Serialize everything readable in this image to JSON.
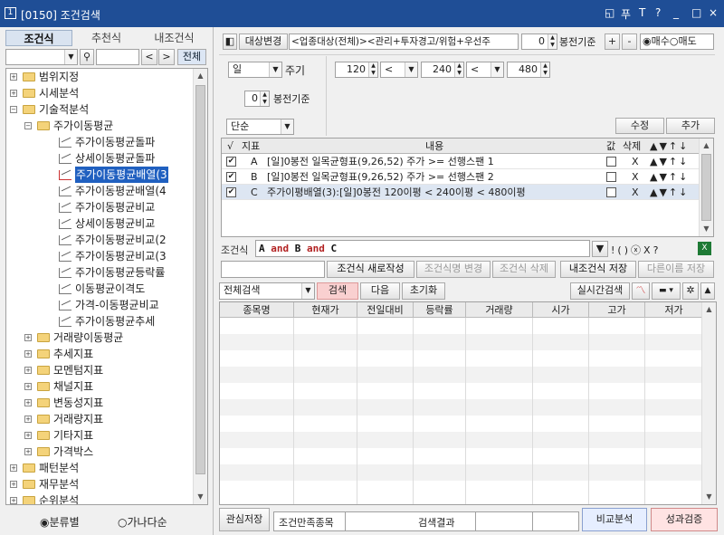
{
  "titlebar": {
    "number": "1",
    "title": "[0150] 조건검색",
    "controls": [
      "◱",
      "푸",
      "T",
      "?",
      "_",
      "□",
      "×"
    ]
  },
  "left": {
    "tabs": [
      "조건식",
      "추천식",
      "내조건식"
    ],
    "search_button": "전체",
    "tree": [
      {
        "label": "범위지정",
        "chev": ">"
      },
      {
        "label": "시세분석",
        "chev": ">"
      },
      {
        "label": "기술적분석",
        "chev": ">"
      },
      {
        "label": "주가이동평균"
      },
      {
        "label": "주가이동평균돌파"
      },
      {
        "label": "상세이동평균돌파"
      },
      {
        "label": "주가이동평균배열(3"
      },
      {
        "label": "주가이동평균배열(4"
      },
      {
        "label": "주가이동평균비교"
      },
      {
        "label": "상세이동평균비교"
      },
      {
        "label": "주가이동평균비교(2"
      },
      {
        "label": "주가이동평균비교(3"
      },
      {
        "label": "주가이동평균등락률"
      },
      {
        "label": "이동평균이격도"
      },
      {
        "label": "가격-이동평균비교"
      },
      {
        "label": "주가이동평균추세"
      },
      {
        "label": "거래량이동평균"
      },
      {
        "label": "추세지표"
      },
      {
        "label": "모멘텀지표"
      },
      {
        "label": "채널지표"
      },
      {
        "label": "변동성지표"
      },
      {
        "label": "거래량지표"
      },
      {
        "label": "기타지표"
      },
      {
        "label": "가격박스"
      },
      {
        "label": "패턴분석",
        "chev": ">"
      },
      {
        "label": "재무분석",
        "chev": ">"
      },
      {
        "label": "순위분석",
        "chev": ">"
      }
    ],
    "radio": [
      "분류별",
      "가나다순"
    ]
  },
  "toolbar": {
    "target_change": "대상변경",
    "target_text": "<업종대상(전체)><관리+투자경고/위험+우선주",
    "bong_value": "0",
    "bong_label": "봉전기준",
    "plus": "+",
    "minus": "-",
    "buy": "매수",
    "sell": "매도"
  },
  "params": {
    "period": "일",
    "period_label": "주기",
    "v1": "120",
    "op1": "<",
    "v2": "240",
    "op2": "<",
    "v3": "480",
    "bong_value": "0",
    "bong_label": "봉전기준",
    "type": "단순",
    "modify": "수정",
    "add": "추가"
  },
  "ctable": {
    "headers": [
      "√",
      "지표",
      "내용",
      "값",
      "삭제"
    ],
    "arrows": "▲▼↑↓",
    "rows": [
      {
        "key": "A",
        "content": "[일]0봉전 일목균형표(9,26,52) 주가 >= 선행스팬 1",
        "del": "X"
      },
      {
        "key": "B",
        "content": "[일]0봉전 일목균형표(9,26,52) 주가 >= 선행스팬 2",
        "del": "X"
      },
      {
        "key": "C",
        "content": "주가이평배열(3):[일]0봉전 120이평 < 240이평 < 480이평",
        "del": "X"
      }
    ]
  },
  "formula": {
    "label": "조건식",
    "parts": [
      {
        "t": "A",
        "c": "#111"
      },
      {
        "t": " and ",
        "c": "#b22222"
      },
      {
        "t": "B",
        "c": "#111"
      },
      {
        "t": " and ",
        "c": "#b22222"
      },
      {
        "t": "C",
        "c": "#111"
      }
    ],
    "ops": [
      "▼",
      "!",
      "(",
      ")",
      "ⓧ",
      "X",
      "?"
    ]
  },
  "actions": {
    "new": "조건식 새로작성",
    "rename": "조건식명 변경",
    "delete": "조건식 삭제",
    "save": "내조건식 저장",
    "saveas": "다른이름 저장"
  },
  "search": {
    "scope": "전체검색",
    "search": "검색",
    "next": "다음",
    "reset": "초기화",
    "realtime": "실시간검색"
  },
  "result": {
    "headers": [
      "종목명",
      "현재가",
      "전일대비",
      "등락률",
      "거래량",
      "시가",
      "고가",
      "저가"
    ]
  },
  "bottom": {
    "save_interest": "관심저장",
    "cond_stocks": "조건만족종목",
    "result_label": "검색결과",
    "compare": "비교분석",
    "verify": "성과검증"
  },
  "colors": {
    "titlebar": "#1f4e96",
    "search_btn": "#f9d0d0",
    "compare": "#e6eeff",
    "verify": "#ffe3e3"
  }
}
